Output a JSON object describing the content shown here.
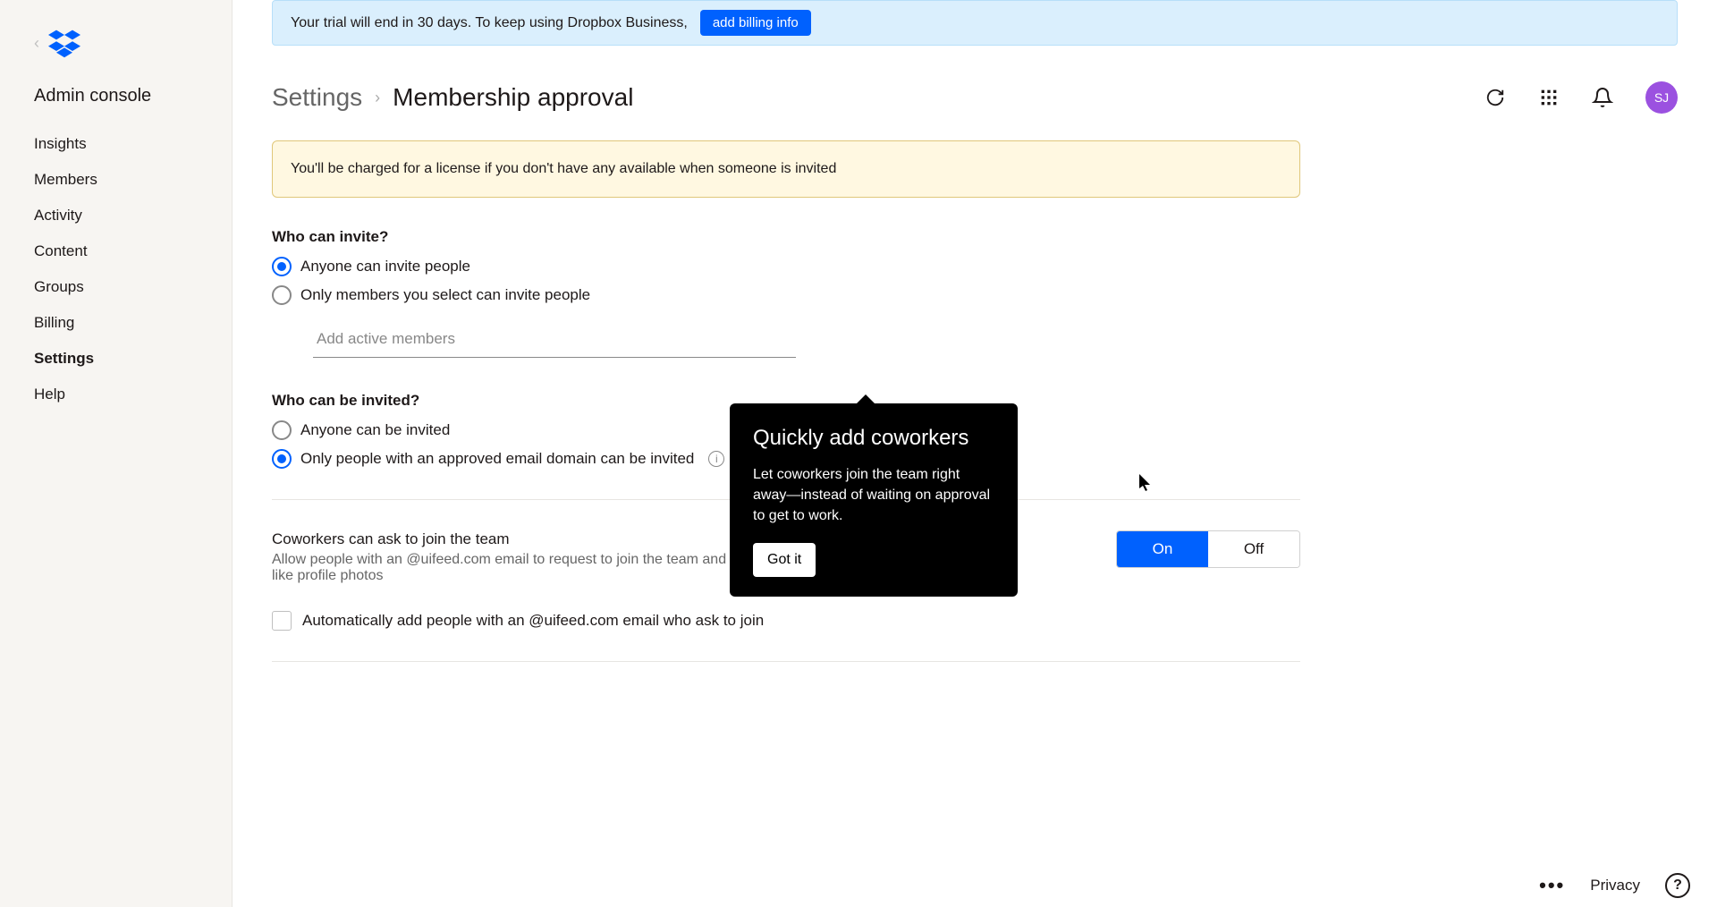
{
  "sidebar": {
    "title": "Admin console",
    "items": [
      {
        "label": "Insights"
      },
      {
        "label": "Members"
      },
      {
        "label": "Activity"
      },
      {
        "label": "Content"
      },
      {
        "label": "Groups"
      },
      {
        "label": "Billing"
      },
      {
        "label": "Settings"
      },
      {
        "label": "Help"
      }
    ],
    "active": "Settings"
  },
  "trial": {
    "text": "Your trial will end in 30 days. To keep using Dropbox Business,",
    "button": "add billing info"
  },
  "breadcrumb": {
    "parent": "Settings",
    "current": "Membership approval"
  },
  "avatar": {
    "initials": "SJ"
  },
  "warning": "You'll be charged for a license if you don't have any available when someone is invited",
  "who_invite": {
    "title": "Who can invite?",
    "opt1": "Anyone can invite people",
    "opt2": "Only members you select can invite people",
    "placeholder": "Add active members"
  },
  "who_invited": {
    "title": "Who can be invited?",
    "opt1": "Anyone can be invited",
    "opt2": "Only people with an approved email domain can be invited"
  },
  "coworkers": {
    "title": "Coworkers can ask to join the team",
    "desc": "Allow people with an @uifeed.com email to request to join the team and to see some basic team info—like profile photos",
    "toggle_on": "On",
    "toggle_off": "Off",
    "auto_add": "Automatically add people with an @uifeed.com email who ask to join"
  },
  "popover": {
    "title": "Quickly add coworkers",
    "body": "Let coworkers join the team right away—instead of waiting on approval to get to work.",
    "button": "Got it"
  },
  "footer": {
    "privacy": "Privacy",
    "help": "?"
  }
}
